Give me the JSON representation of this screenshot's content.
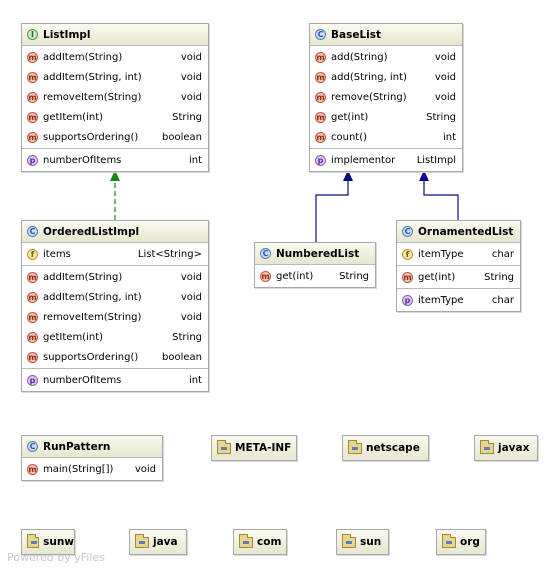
{
  "classes": {
    "list_impl": {
      "name": "ListImpl",
      "kind": "I",
      "methods": [
        {
          "name": "addItem(String)",
          "type": "void"
        },
        {
          "name": "addItem(String, int)",
          "type": "void"
        },
        {
          "name": "removeItem(String)",
          "type": "void"
        },
        {
          "name": "getItem(int)",
          "type": "String"
        },
        {
          "name": "supportsOrdering()",
          "type": "boolean"
        }
      ],
      "properties": [
        {
          "name": "numberOfItems",
          "type": "int"
        }
      ]
    },
    "base_list": {
      "name": "BaseList",
      "kind": "C",
      "methods": [
        {
          "name": "add(String)",
          "type": "void"
        },
        {
          "name": "add(String, int)",
          "type": "void"
        },
        {
          "name": "remove(String)",
          "type": "void"
        },
        {
          "name": "get(int)",
          "type": "String"
        },
        {
          "name": "count()",
          "type": "int"
        }
      ],
      "properties": [
        {
          "name": "implementor",
          "type": "ListImpl"
        }
      ]
    },
    "ordered_list_impl": {
      "name": "OrderedListImpl",
      "kind": "C",
      "fields": [
        {
          "name": "items",
          "type": "List<String>"
        }
      ],
      "methods": [
        {
          "name": "addItem(String)",
          "type": "void"
        },
        {
          "name": "addItem(String, int)",
          "type": "void"
        },
        {
          "name": "removeItem(String)",
          "type": "void"
        },
        {
          "name": "getItem(int)",
          "type": "String"
        },
        {
          "name": "supportsOrdering()",
          "type": "boolean"
        }
      ],
      "properties": [
        {
          "name": "numberOfItems",
          "type": "int"
        }
      ]
    },
    "numbered_list": {
      "name": "NumberedList",
      "kind": "C",
      "methods": [
        {
          "name": "get(int)",
          "type": "String"
        }
      ]
    },
    "ornamented_list": {
      "name": "OrnamentedList",
      "kind": "C",
      "fields": [
        {
          "name": "itemType",
          "type": "char"
        }
      ],
      "methods": [
        {
          "name": "get(int)",
          "type": "String"
        }
      ],
      "properties": [
        {
          "name": "itemType",
          "type": "char"
        }
      ]
    },
    "run_pattern": {
      "name": "RunPattern",
      "kind": "C",
      "methods": [
        {
          "name": "main(String[])",
          "type": "void"
        }
      ]
    }
  },
  "badges": {
    "interface": "I",
    "class": "C",
    "method": "m",
    "field": "f",
    "property": "p"
  },
  "packages": [
    "META-INF",
    "netscape",
    "javax",
    "sunw",
    "java",
    "com",
    "sun",
    "org"
  ],
  "watermark": "Powered by yFiles",
  "colors": {
    "realization_edge": "#138a13",
    "inheritance_edge": "#0b0b8a"
  }
}
